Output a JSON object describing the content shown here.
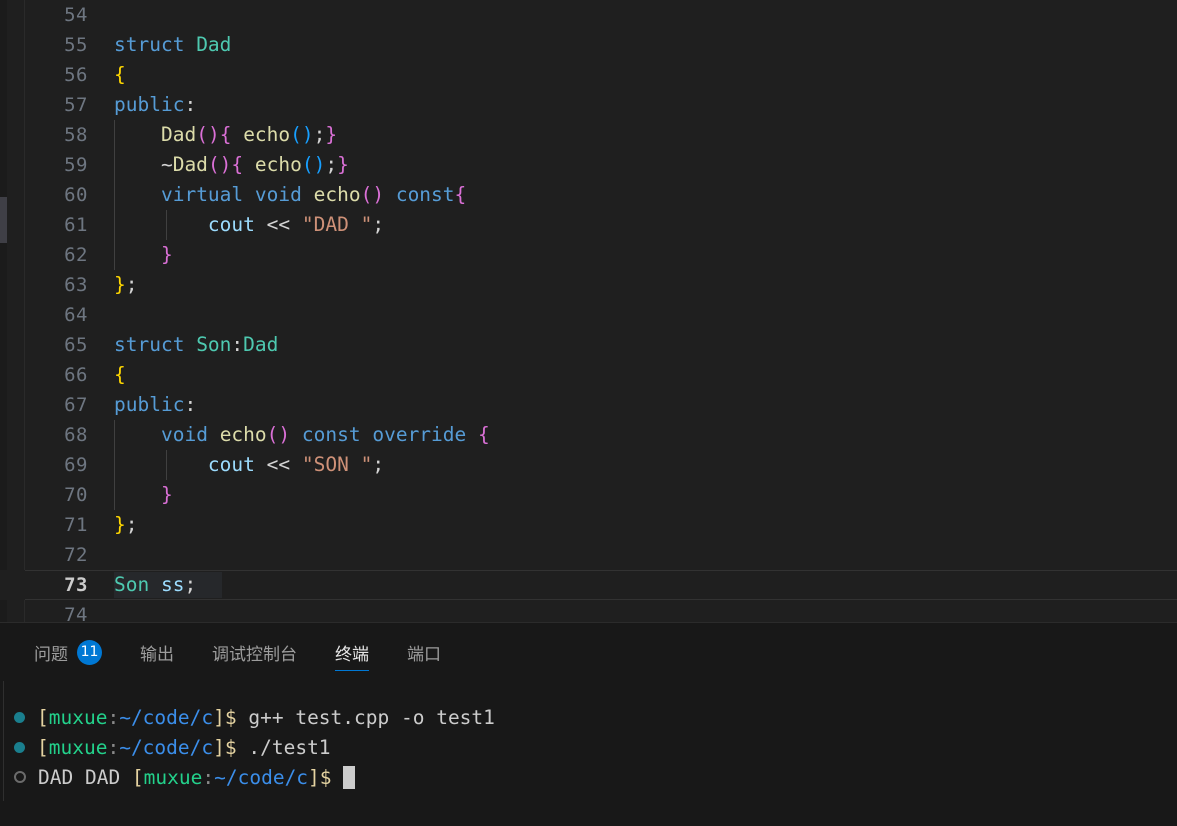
{
  "editor": {
    "language": "cpp",
    "current_line": 73,
    "first_visible_line": 54,
    "last_visible_line": 74,
    "theme_colors": {
      "background": "#1f1f1f",
      "line_number": "#6e7681",
      "line_number_active": "#cccccc",
      "keyword": "#569cd6",
      "type": "#4ec9b0",
      "function": "#dcdcaa",
      "variable": "#9cdcfe",
      "string": "#ce9178",
      "bracket_yellow": "#ffd700",
      "bracket_pink": "#da70d6",
      "bracket_blue": "#179fff"
    },
    "lines": [
      {
        "num": "54",
        "tokens": []
      },
      {
        "num": "55",
        "tokens": [
          {
            "t": "struct ",
            "c": "kw"
          },
          {
            "t": "Dad",
            "c": "type"
          }
        ]
      },
      {
        "num": "56",
        "tokens": [
          {
            "t": "{",
            "c": "by"
          }
        ]
      },
      {
        "num": "57",
        "tokens": [
          {
            "t": "public",
            "c": "kw"
          },
          {
            "t": ":",
            "c": "plain"
          }
        ]
      },
      {
        "num": "58",
        "indent": 1,
        "tokens": [
          {
            "t": "    ",
            "c": "plain"
          },
          {
            "t": "Dad",
            "c": "fn"
          },
          {
            "t": "()",
            "c": "bp"
          },
          {
            "t": "{",
            "c": "bp"
          },
          {
            "t": " ",
            "c": "plain"
          },
          {
            "t": "echo",
            "c": "fn"
          },
          {
            "t": "()",
            "c": "bb"
          },
          {
            "t": ";",
            "c": "plain"
          },
          {
            "t": "}",
            "c": "bp"
          }
        ]
      },
      {
        "num": "59",
        "indent": 1,
        "tokens": [
          {
            "t": "    ~",
            "c": "plain"
          },
          {
            "t": "Dad",
            "c": "fn"
          },
          {
            "t": "()",
            "c": "bp"
          },
          {
            "t": "{",
            "c": "bp"
          },
          {
            "t": " ",
            "c": "plain"
          },
          {
            "t": "echo",
            "c": "fn"
          },
          {
            "t": "()",
            "c": "bb"
          },
          {
            "t": ";",
            "c": "plain"
          },
          {
            "t": "}",
            "c": "bp"
          }
        ]
      },
      {
        "num": "60",
        "indent": 1,
        "tokens": [
          {
            "t": "    ",
            "c": "plain"
          },
          {
            "t": "virtual",
            "c": "kw"
          },
          {
            "t": " ",
            "c": "plain"
          },
          {
            "t": "void",
            "c": "kw"
          },
          {
            "t": " ",
            "c": "plain"
          },
          {
            "t": "echo",
            "c": "fn"
          },
          {
            "t": "()",
            "c": "bp"
          },
          {
            "t": " ",
            "c": "plain"
          },
          {
            "t": "const",
            "c": "kw"
          },
          {
            "t": "{",
            "c": "bp"
          }
        ]
      },
      {
        "num": "61",
        "indent": 2,
        "tokens": [
          {
            "t": "        ",
            "c": "plain"
          },
          {
            "t": "cout",
            "c": "var"
          },
          {
            "t": " ",
            "c": "plain"
          },
          {
            "t": "<<",
            "c": "op"
          },
          {
            "t": " ",
            "c": "plain"
          },
          {
            "t": "\"DAD \"",
            "c": "str"
          },
          {
            "t": ";",
            "c": "plain"
          }
        ]
      },
      {
        "num": "62",
        "indent": 1,
        "tokens": [
          {
            "t": "    ",
            "c": "plain"
          },
          {
            "t": "}",
            "c": "bp"
          }
        ]
      },
      {
        "num": "63",
        "tokens": [
          {
            "t": "}",
            "c": "by"
          },
          {
            "t": ";",
            "c": "plain"
          }
        ]
      },
      {
        "num": "64",
        "tokens": []
      },
      {
        "num": "65",
        "tokens": [
          {
            "t": "struct ",
            "c": "kw"
          },
          {
            "t": "Son",
            "c": "type"
          },
          {
            "t": ":",
            "c": "plain"
          },
          {
            "t": "Dad",
            "c": "type"
          }
        ]
      },
      {
        "num": "66",
        "tokens": [
          {
            "t": "{",
            "c": "by"
          }
        ]
      },
      {
        "num": "67",
        "tokens": [
          {
            "t": "public",
            "c": "kw"
          },
          {
            "t": ":",
            "c": "plain"
          }
        ]
      },
      {
        "num": "68",
        "indent": 1,
        "tokens": [
          {
            "t": "    ",
            "c": "plain"
          },
          {
            "t": "void",
            "c": "kw"
          },
          {
            "t": " ",
            "c": "plain"
          },
          {
            "t": "echo",
            "c": "fn"
          },
          {
            "t": "()",
            "c": "bp"
          },
          {
            "t": " ",
            "c": "plain"
          },
          {
            "t": "const",
            "c": "kw"
          },
          {
            "t": " ",
            "c": "plain"
          },
          {
            "t": "override",
            "c": "kw"
          },
          {
            "t": " ",
            "c": "plain"
          },
          {
            "t": "{",
            "c": "bp"
          }
        ]
      },
      {
        "num": "69",
        "indent": 2,
        "tokens": [
          {
            "t": "        ",
            "c": "plain"
          },
          {
            "t": "cout",
            "c": "var"
          },
          {
            "t": " ",
            "c": "plain"
          },
          {
            "t": "<<",
            "c": "op"
          },
          {
            "t": " ",
            "c": "plain"
          },
          {
            "t": "\"SON \"",
            "c": "str"
          },
          {
            "t": ";",
            "c": "plain"
          }
        ]
      },
      {
        "num": "70",
        "indent": 1,
        "tokens": [
          {
            "t": "    ",
            "c": "plain"
          },
          {
            "t": "}",
            "c": "bp"
          }
        ]
      },
      {
        "num": "71",
        "tokens": [
          {
            "t": "}",
            "c": "by"
          },
          {
            "t": ";",
            "c": "plain"
          }
        ]
      },
      {
        "num": "72",
        "tokens": []
      },
      {
        "num": "73",
        "current": true,
        "tokens": [
          {
            "t": "Son",
            "c": "type"
          },
          {
            "t": " ",
            "c": "plain"
          },
          {
            "t": "ss",
            "c": "var"
          },
          {
            "t": ";",
            "c": "plain"
          }
        ]
      },
      {
        "num": "74",
        "tokens": []
      }
    ]
  },
  "panel": {
    "tabs": [
      {
        "label": "问题",
        "badge": "11",
        "active": false,
        "name": "tab-problems"
      },
      {
        "label": "输出",
        "badge": null,
        "active": false,
        "name": "tab-output"
      },
      {
        "label": "调试控制台",
        "badge": null,
        "active": false,
        "name": "tab-debug-console"
      },
      {
        "label": "终端",
        "badge": null,
        "active": true,
        "name": "tab-terminal"
      },
      {
        "label": "端口",
        "badge": null,
        "active": false,
        "name": "tab-ports"
      }
    ],
    "accent_color": "#0078d4"
  },
  "terminal": {
    "lines": [
      {
        "decoration": "success",
        "segments": [
          {
            "t": "[",
            "c": "tbr"
          },
          {
            "t": "muxue",
            "c": "tuser"
          },
          {
            "t": ":",
            "c": "tcol"
          },
          {
            "t": "~/code/c",
            "c": "tpath"
          },
          {
            "t": "]",
            "c": "tbr"
          },
          {
            "t": "$",
            "c": "tdoll"
          },
          {
            "t": " g++ test.cpp -o test1",
            "c": "tcmd"
          }
        ]
      },
      {
        "decoration": "success",
        "segments": [
          {
            "t": "[",
            "c": "tbr"
          },
          {
            "t": "muxue",
            "c": "tuser"
          },
          {
            "t": ":",
            "c": "tcol"
          },
          {
            "t": "~/code/c",
            "c": "tpath"
          },
          {
            "t": "]",
            "c": "tbr"
          },
          {
            "t": "$",
            "c": "tdoll"
          },
          {
            "t": " ./test1",
            "c": "tcmd"
          }
        ]
      },
      {
        "decoration": "running",
        "segments": [
          {
            "t": "DAD DAD ",
            "c": "tout"
          },
          {
            "t": "[",
            "c": "tbr"
          },
          {
            "t": "muxue",
            "c": "tuser"
          },
          {
            "t": ":",
            "c": "tcol"
          },
          {
            "t": "~/code/c",
            "c": "tpath"
          },
          {
            "t": "]",
            "c": "tbr"
          },
          {
            "t": "$",
            "c": "tdoll"
          },
          {
            "t": " ",
            "c": "tcmd"
          }
        ],
        "cursor": true
      }
    ]
  }
}
